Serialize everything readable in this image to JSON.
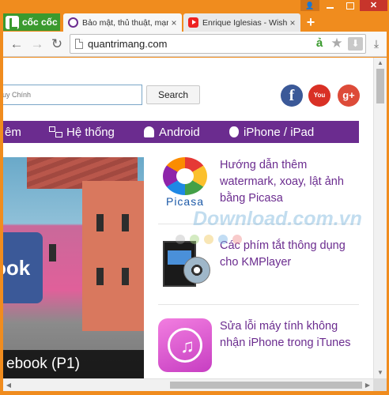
{
  "browser": {
    "brand": "cốc cốc",
    "tabs": [
      {
        "title": "Bảo mật, thủ thuật, mạng",
        "active": true
      },
      {
        "title": "Enrique Iglesias - Wish I",
        "active": false
      }
    ],
    "new_tab_label": "+",
    "close_glyph": "×",
    "url": "quantrimang.com",
    "omnibox_badge": "ả",
    "window_controls": {
      "user": "👤",
      "close": "✕"
    }
  },
  "page": {
    "search": {
      "placeholder": "uy Chính",
      "button": "Search"
    },
    "social": {
      "facebook": "f",
      "youtube": "You Tube",
      "googleplus": "g+"
    },
    "nav": [
      {
        "label": "êm"
      },
      {
        "label": "Hệ thống",
        "icon": "network-icon"
      },
      {
        "label": "Android",
        "icon": "android-icon"
      },
      {
        "label": "iPhone / iPad",
        "icon": "apple-icon"
      }
    ],
    "hero": {
      "caption": "ebook (P1)",
      "logo_text": "ook"
    },
    "watermark": "Download.com.vn",
    "articles": [
      {
        "title": "Hướng dẫn thêm watermark, xoay, lật ảnh bằng Picasa",
        "thumb_text": "Picasa"
      },
      {
        "title": "Các phím tắt thông dụng cho KMPlayer"
      },
      {
        "title": "Sửa lỗi máy tính không nhận iPhone trong iTunes",
        "thumb_text": "♫"
      }
    ]
  },
  "colors": {
    "chrome_orange": "#f08c1e",
    "brand_green": "#3a9a2e",
    "nav_purple": "#6b2c8f",
    "link_purple": "#6b2c8f"
  }
}
